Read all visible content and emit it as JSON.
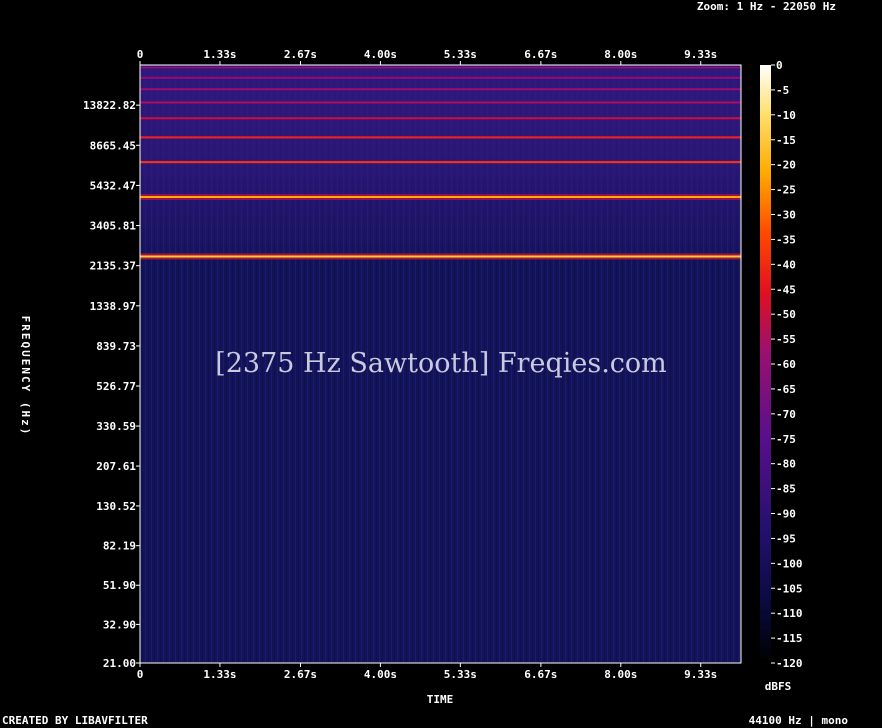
{
  "header": {
    "zoom": "Zoom: 1 Hz - 22050 Hz"
  },
  "footer": {
    "created_by": "CREATED BY LIBAVFILTER",
    "format": "44100 Hz | mono"
  },
  "watermark": "[2375 Hz Sawtooth] Freqies.com",
  "colors": {
    "background": "#000000",
    "plot_background": "#14145a",
    "axis": "#ffffff"
  },
  "chart_data": {
    "type": "heatmap",
    "xlabel": "TIME",
    "ylabel": "FREQUENCY (Hz)",
    "colorbar_label": "dBFS",
    "x_ticks": [
      "0",
      "1.33s",
      "2.67s",
      "4.00s",
      "5.33s",
      "6.67s",
      "8.00s",
      "9.33s"
    ],
    "x_tick_values": [
      0,
      1.33,
      2.67,
      4.0,
      5.33,
      6.67,
      8.0,
      9.33
    ],
    "xlim": [
      0,
      10
    ],
    "y_ticks": [
      "21.00",
      "32.90",
      "51.90",
      "82.19",
      "130.52",
      "207.61",
      "330.59",
      "526.77",
      "839.73",
      "1338.97",
      "2135.37",
      "3405.81",
      "5432.47",
      "8665.45",
      "13822.82"
    ],
    "y_tick_values": [
      21.0,
      32.9,
      51.9,
      82.19,
      130.52,
      207.61,
      330.59,
      526.77,
      839.73,
      1338.97,
      2135.37,
      3405.81,
      5432.47,
      8665.45,
      13822.82
    ],
    "ylim": [
      21,
      22050
    ],
    "y_scale": "log",
    "colorbar_ticks": [
      "0",
      "-5",
      "-10",
      "-15",
      "-20",
      "-25",
      "-30",
      "-35",
      "-40",
      "-45",
      "-50",
      "-55",
      "-60",
      "-65",
      "-70",
      "-75",
      "-80",
      "-85",
      "-90",
      "-95",
      "-100",
      "-105",
      "-110",
      "-115",
      "-120"
    ],
    "colorbar_range": [
      -120,
      0
    ],
    "noise_floor_dbfs": -105,
    "harmonics": [
      {
        "freq": 2375,
        "dbfs": -15
      },
      {
        "freq": 4750,
        "dbfs": -22
      },
      {
        "freq": 7125,
        "dbfs": -38
      },
      {
        "freq": 9500,
        "dbfs": -42
      },
      {
        "freq": 11875,
        "dbfs": -50
      },
      {
        "freq": 14250,
        "dbfs": -55
      },
      {
        "freq": 16625,
        "dbfs": -58
      },
      {
        "freq": 19000,
        "dbfs": -60
      },
      {
        "freq": 21375,
        "dbfs": -62
      }
    ]
  }
}
